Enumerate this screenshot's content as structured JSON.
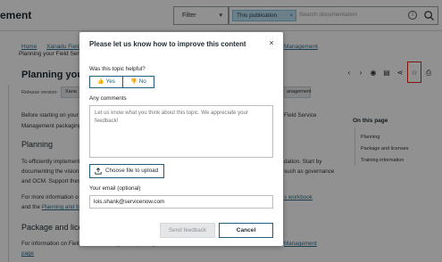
{
  "header": {
    "brand_partial": "ement",
    "filter_label": "Filter",
    "scope_chip": "This publication",
    "search_placeholder": "Search documentation"
  },
  "breadcrumb": {
    "home": "Home",
    "second_partial": "Xanadu Field",
    "right_partial": "Management",
    "sub_partial": "Planning your Field Servic"
  },
  "article": {
    "title_partial": "Planning your",
    "release_label": "Release version:",
    "release_tag": "Xana",
    "release_tag_right": "anagement",
    "intro_left": "Before starting on your",
    "intro_left_2": "Management packaging",
    "intro_right": "Field Service",
    "section_planning": "Planning",
    "planning_left_1": "To efficiently implement",
    "planning_left_2": "documenting the vision",
    "planning_left_3": "and OCM. Support thes",
    "planning_right_1": "dation. Start by",
    "planning_right_2": "such as governance",
    "more_info_left": "For more information o",
    "more_info_right": "s workbook",
    "and_the": "and the",
    "planning_link": "Planning and b",
    "section_package": "Package and licens",
    "package_left": "For information on Field Service Management packages and licenses, see",
    "package_right_link": "Management",
    "page_link": "page"
  },
  "toc": {
    "title": "On this page",
    "items": [
      "Planning",
      "Package and licenses",
      "Training information"
    ]
  },
  "modal": {
    "title": "Please let us know how to improve this content",
    "close_glyph": "×",
    "helpful_question": "Was this topic helpful?",
    "yes_label": "Yes",
    "no_label": "No",
    "comments_label": "Any comments",
    "comments_placeholder": "Let us know what you think about this topic. We appreciate your feedback!",
    "upload_label": "Choose file to upload",
    "email_label": "Your email (optional)",
    "email_value": "lois.shank@servicenow.com",
    "send_label": "Send feedback",
    "cancel_label": "Cancel"
  },
  "colors": {
    "accent": "#1f5a78",
    "highlight_box": "#e0251b",
    "chip_bg": "#bfe1f2"
  }
}
